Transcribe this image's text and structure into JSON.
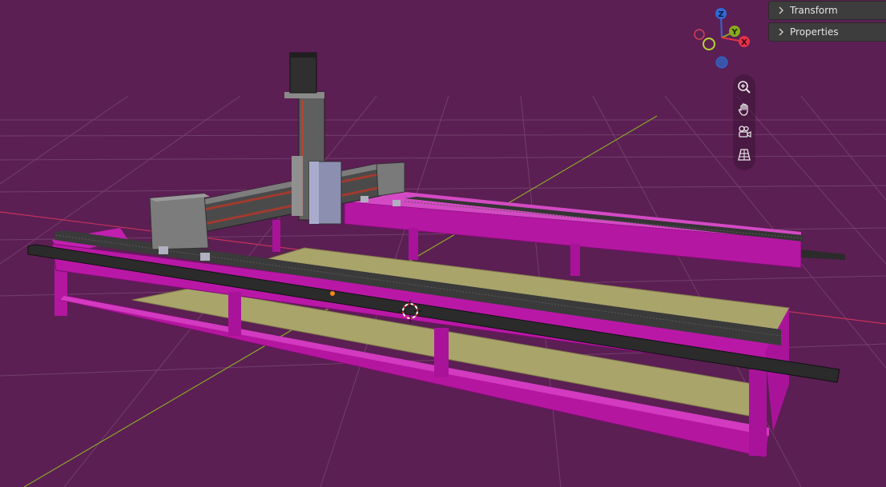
{
  "panels": {
    "transform_label": "Transform",
    "properties_label": "Properties"
  },
  "gizmo": {
    "z_label": "Z",
    "y_label": "Y",
    "x_label": "X",
    "colors": {
      "x": "#e2334a",
      "y": "#89ab1c",
      "z": "#2f6ad6"
    }
  },
  "nav_tools": {
    "items": [
      "zoom-icon",
      "pan-hand-icon",
      "camera-view-icon",
      "perspective-grid-icon"
    ]
  },
  "scene": {
    "background_color": "#5b1f53",
    "frame_color": "#b0169f",
    "bed_color": "#a4a064",
    "rail_color": "#2c2c2c"
  }
}
